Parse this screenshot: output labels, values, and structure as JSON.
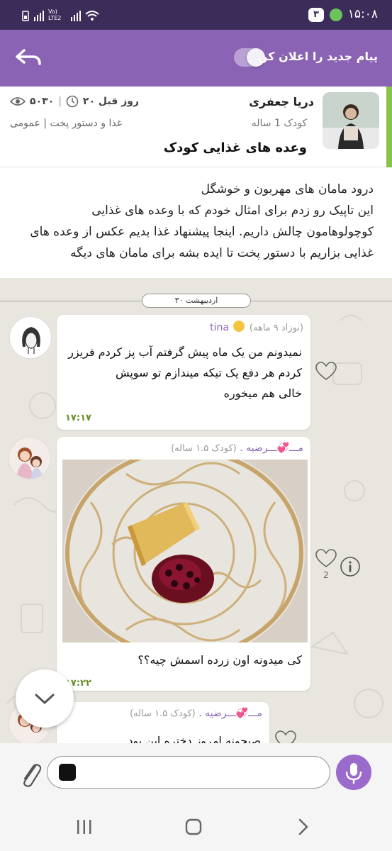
{
  "status": {
    "time": "۱۵:۰۸",
    "notification_count": "۳",
    "network": "Vo) LTE2"
  },
  "topbar": {
    "notify_label": "پیام جدید را اعلان کن"
  },
  "topic": {
    "author": "دریا جعفری",
    "child_age": "کودک 1 ساله",
    "title": "وعده های غذایی کودک",
    "views": "۵۰۳۰",
    "posted": "۲۰ روز قبل",
    "category": "غذا و دستور پخت | عمومی",
    "intro_lines": [
      "درود مامان های مهربون و خوشگل",
      "این تاپیک رو زدم برای امثال خودم که با وعده های غذایی",
      "کوچولوهامون چالش داریم. اینجا پیشنهاد غذا بدیم عکس از وعده های",
      "غذایی بزاریم با دستور پخت تا ایده بشه برای مامان های دیگه"
    ]
  },
  "chat": {
    "date_separator": "۳۰ اردیبهشت",
    "messages": [
      {
        "user": "tina",
        "user_meta": "(نوزاد ۹ ماهه)",
        "lines": [
          "نمیدونم من یک ماه پیش گرفتم آب پز کردم فریزر",
          "کردم هر دفع یک تیکه میندازم تو سوپش",
          "خالی هم میخوره"
        ],
        "time": "۱۷:۱۷"
      },
      {
        "user": "مـــ💞ـــرضیه .",
        "user_meta": "(کودک ۱.۵ ساله)",
        "caption": "کی میدونه اون زرده اسمش چیه؟؟",
        "time": "۱۷:۲۲",
        "likes": "2"
      },
      {
        "user": "مـــ💞ـــرضیه .",
        "user_meta": "(کودک ۱.۵ ساله)",
        "partial_text": "صبحونه امروز دختره این بود"
      }
    ]
  },
  "colors": {
    "status_bar": "#3b2c59",
    "top_bar": "#8b63b5",
    "accent_green": "#8bc34a",
    "username": "#8a66b5",
    "time_green": "#6a8f2a",
    "mic_button": "#9b6bcc"
  },
  "icons": {
    "back": "back-arrow-icon",
    "views": "eye-icon",
    "clock": "clock-icon",
    "like": "heart-icon",
    "info": "info-icon",
    "scroll": "chevron-down-icon",
    "attach": "paperclip-icon",
    "mic": "microphone-icon"
  }
}
